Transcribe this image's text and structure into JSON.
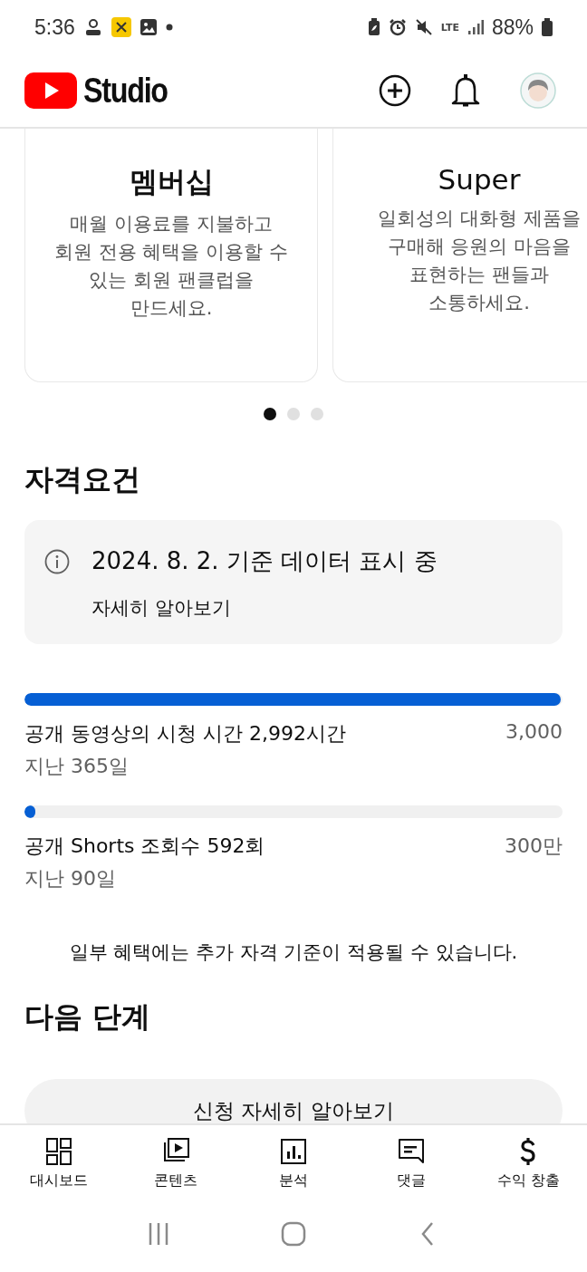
{
  "status_bar": {
    "time": "5:36",
    "network": "LTE",
    "battery": "88%"
  },
  "app_bar": {
    "title": "Studio"
  },
  "cards": [
    {
      "title": "멤버십",
      "description": "매월 이용료를 지불하고 회원 전용 혜택을 이용할 수 있는 회원 팬클럽을 만드세요."
    },
    {
      "title": "Super",
      "description": "일회성의 대화형 제품을 구매해 응원의 마음을 표현하는 팬들과 소통하세요."
    }
  ],
  "carousel_dots": [
    {
      "selected": true
    },
    {
      "selected": false
    },
    {
      "selected": false
    }
  ],
  "eligibility": {
    "heading": "자격요건",
    "notice": "2024. 8. 2. 기준 데이터 표시 중",
    "link": "자세히 알아보기",
    "requirements": [
      {
        "label": "공개 동영상의 시청 시간 2,992시간",
        "target": "3,000",
        "period": "지난 365일",
        "level": 0.997
      },
      {
        "label": "공개 Shorts 조회수 592회",
        "target": "300만",
        "period": "지난 90일",
        "level": 0.0002
      }
    ],
    "footnote": "일부 혜택에는 추가 자격 기준이 적용될 수 있습니다."
  },
  "next_steps": {
    "heading": "다음 단계",
    "button": "신청 자세히 알아보기"
  },
  "bottom_nav": [
    {
      "kind": "dashboard",
      "label": "대시보드"
    },
    {
      "kind": "content",
      "label": "콘텐츠"
    },
    {
      "kind": "analytics",
      "label": "분석"
    },
    {
      "kind": "comments",
      "label": "댓글"
    },
    {
      "kind": "earn",
      "label": "수익 창출"
    }
  ]
}
